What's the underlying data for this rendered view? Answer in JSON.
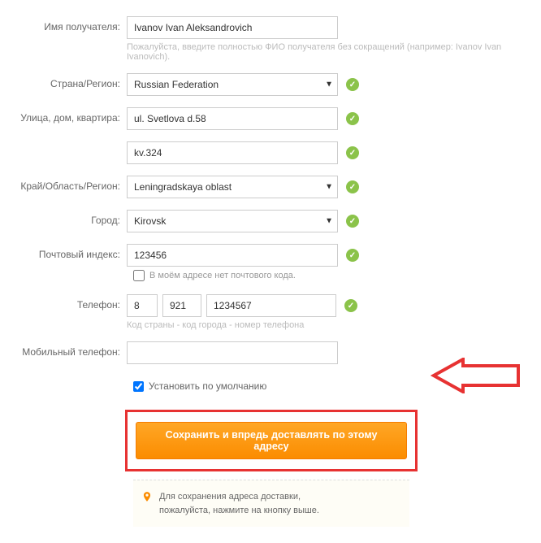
{
  "recipient": {
    "label": "Имя получателя:",
    "value": "Ivanov Ivan Aleksandrovich",
    "hint": "Пожалуйста, введите полностью ФИО получателя без сокращений (например: Ivanov Ivan Ivanovich)."
  },
  "country": {
    "label": "Страна/Регион:",
    "value": "Russian Federation"
  },
  "street": {
    "label": "Улица, дом, квартира:",
    "value1": "ul. Svetlova d.58",
    "value2": "kv.324"
  },
  "region": {
    "label": "Край/Область/Регион:",
    "value": "Leningradskaya oblast"
  },
  "city": {
    "label": "Город:",
    "value": "Kirovsk"
  },
  "postal": {
    "label": "Почтовый индекс:",
    "value": "123456",
    "no_postal_label": "В моём адресе нет почтового кода."
  },
  "phone": {
    "label": "Телефон:",
    "country_code": "8",
    "area_code": "921",
    "number": "1234567",
    "hint": "Код страны - код города - номер телефона"
  },
  "mobile": {
    "label": "Мобильный телефон:",
    "value": ""
  },
  "default_cb": {
    "label": "Установить по умолчанию",
    "checked": true
  },
  "save_btn": "Сохранить и впредь доставлять по этому адресу",
  "notice": {
    "line1": "Для сохранения адреса доставки,",
    "line2": "пожалуйста, нажмите на кнопку выше."
  },
  "colors": {
    "accent": "#fb8c00",
    "valid": "#8bc34a",
    "highlight": "#e73232"
  }
}
